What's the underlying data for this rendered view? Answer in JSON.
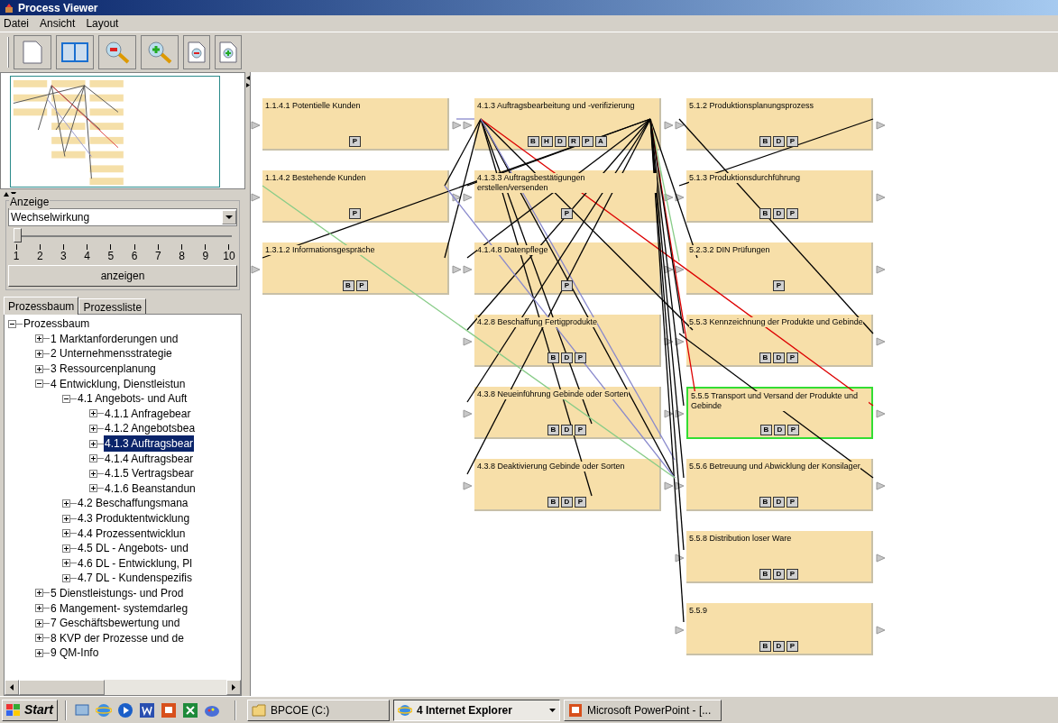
{
  "window": {
    "title": "Process Viewer"
  },
  "menu": [
    "Datei",
    "Ansicht",
    "Layout"
  ],
  "anzeige": {
    "title": "Anzeige",
    "dropdown_value": "Wechselwirkung",
    "slider": {
      "level": 0,
      "ticks": [
        "1",
        "2",
        "3",
        "4",
        "5",
        "6",
        "7",
        "8",
        "9",
        "10"
      ]
    },
    "button": "anzeigen"
  },
  "tabs": [
    {
      "label": "Prozessbaum",
      "selected": true
    },
    {
      "label": "Prozessliste",
      "selected": false
    }
  ],
  "tree": {
    "label": "Prozessbaum",
    "expanded": true,
    "selected": false,
    "children": [
      {
        "label": "1 Marktanforderungen und",
        "expanded": false,
        "selected": false
      },
      {
        "label": "2 Unternehmensstrategie",
        "expanded": false,
        "selected": false
      },
      {
        "label": "3 Ressourcenplanung",
        "expanded": false,
        "selected": false
      },
      {
        "label": "4 Entwicklung, Dienstleistun",
        "expanded": true,
        "selected": false,
        "children": [
          {
            "label": "4.1 Angebots- und Auft",
            "expanded": true,
            "selected": false,
            "children": [
              {
                "label": "4.1.1 Anfragebear",
                "expanded": false,
                "selected": false
              },
              {
                "label": "4.1.2 Angebotsbea",
                "expanded": false,
                "selected": false
              },
              {
                "label": "4.1.3 Auftragsbear",
                "expanded": false,
                "selected": true
              },
              {
                "label": "4.1.4 Auftragsbear",
                "expanded": false,
                "selected": false
              },
              {
                "label": "4.1.5 Vertragsbear",
                "expanded": false,
                "selected": false
              },
              {
                "label": "4.1.6 Beanstandun",
                "expanded": false,
                "selected": false
              }
            ]
          },
          {
            "label": "4.2 Beschaffungsmana",
            "expanded": false,
            "selected": false
          },
          {
            "label": "4.3 Produktentwicklung",
            "expanded": false,
            "selected": false
          },
          {
            "label": "4.4 Prozessentwicklun",
            "expanded": false,
            "selected": false
          },
          {
            "label": "4.5 DL - Angebots- und",
            "expanded": false,
            "selected": false
          },
          {
            "label": "4.6 DL - Entwicklung, Pl",
            "expanded": false,
            "selected": false
          },
          {
            "label": "4.7 DL - Kundenspezifis",
            "expanded": false,
            "selected": false
          }
        ]
      },
      {
        "label": "5 Dienstleistungs- und Prod",
        "expanded": false,
        "selected": false
      },
      {
        "label": "6 Mangement- systemdarleg",
        "expanded": false,
        "selected": false
      },
      {
        "label": "7 Geschäftsbewertung und",
        "expanded": false,
        "selected": false
      },
      {
        "label": "8 KVP der Prozesse und de",
        "expanded": false,
        "selected": false
      },
      {
        "label": "9 QM-Info",
        "expanded": false,
        "selected": false
      }
    ]
  },
  "canvas": {
    "columns": [
      {
        "nodes": [
          {
            "title": "1.1.4.1 Potentielle Kunden",
            "badges": [
              "P"
            ],
            "selected": false
          },
          {
            "title": "1.1.4.2 Bestehende Kunden",
            "badges": [
              "P"
            ],
            "selected": false
          },
          {
            "title": "1.3.1.2 Informationsgespräche",
            "badges": [
              "B",
              "P"
            ],
            "selected": false
          }
        ]
      },
      {
        "nodes": [
          {
            "title": "4.1.3 Auftragsbearbeitung und -verifizierung",
            "badges": [
              "B",
              "H",
              "D",
              "R",
              "P",
              "A"
            ],
            "selected": false
          },
          {
            "title": "4.1.3.3 Auftragsbestätigungen erstellen/versenden",
            "badges": [
              "P"
            ],
            "selected": false
          },
          {
            "title": "4.1.4.8 Datenpflege",
            "badges": [
              "P"
            ],
            "selected": false
          },
          {
            "title": "4.2.8 Beschaffung Fertigprodukte",
            "badges": [
              "B",
              "D",
              "P"
            ],
            "selected": false
          },
          {
            "title": "4.3.8 Neueinführung Gebinde oder Sorten",
            "badges": [
              "B",
              "D",
              "P"
            ],
            "selected": false
          },
          {
            "title": "4.3.8 Deaktivierung Gebinde oder Sorten",
            "badges": [
              "B",
              "D",
              "P"
            ],
            "selected": false
          }
        ]
      },
      {
        "nodes": [
          {
            "title": "5.1.2 Produktionsplanungsprozess",
            "badges": [
              "B",
              "D",
              "P"
            ],
            "selected": false
          },
          {
            "title": "5.1.3 Produktionsdurchführung",
            "badges": [
              "B",
              "D",
              "P"
            ],
            "selected": false
          },
          {
            "title": "5.2.3.2 DIN Prüfungen",
            "badges": [
              "P"
            ],
            "selected": false
          },
          {
            "title": "5.5.3 Kennzeichnung der Produkte und Gebinde",
            "badges": [
              "B",
              "D",
              "P"
            ],
            "selected": false
          },
          {
            "title": "5.5.5 Transport und Versand der Produkte und Gebinde",
            "badges": [
              "B",
              "D",
              "P"
            ],
            "selected": true
          },
          {
            "title": "5.5.6 Betreuung und Abwicklung der Konsilager",
            "badges": [
              "B",
              "D",
              "P"
            ],
            "selected": false
          },
          {
            "title": "5.5.8 Distribution loser Ware",
            "badges": [
              "B",
              "D",
              "P"
            ],
            "selected": false
          },
          {
            "title": "5.5.9",
            "badges": [
              "B",
              "D",
              "P"
            ],
            "selected": false
          }
        ]
      }
    ]
  },
  "taskbar": {
    "start": "Start",
    "tasks": [
      {
        "label": "BPCOE (C:)",
        "kind": "folder",
        "selected": false
      },
      {
        "label": "4 Internet Explorer",
        "kind": "browser",
        "selected": true
      },
      {
        "label": "Microsoft PowerPoint - [...",
        "kind": "slides",
        "selected": false
      }
    ]
  }
}
